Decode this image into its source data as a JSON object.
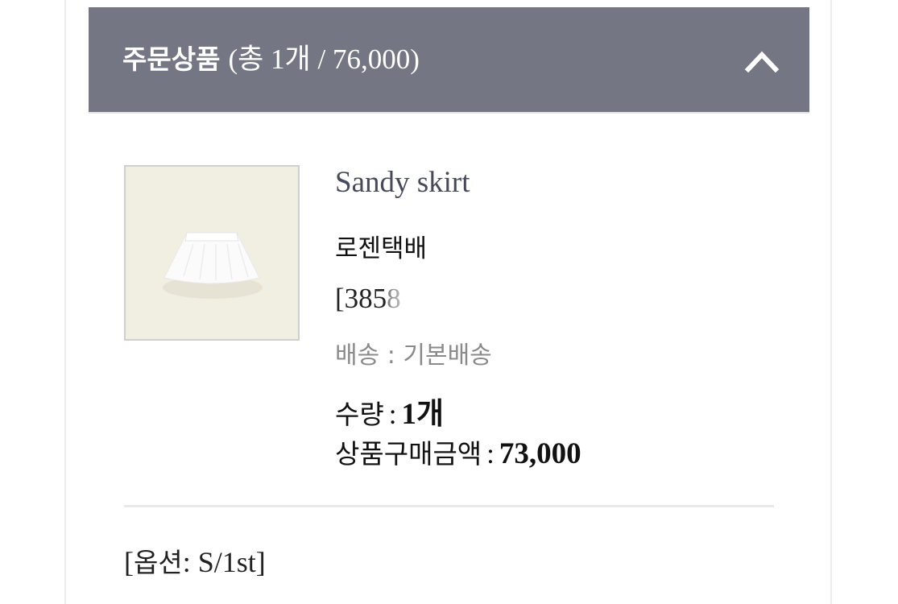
{
  "order_header": {
    "label": "주문상품",
    "summary": "(총 1개 / 76,000)",
    "toggle_icon": "chevron-up-icon",
    "background_color": "#757683"
  },
  "product": {
    "name": "Sandy skirt",
    "carrier": "로젠택배",
    "tracking_code": "[3858",
    "shipping": "배송 : 기본배송",
    "quantity_label": "수량",
    "quantity_value": "1개",
    "price_label": "상품구매금액",
    "price_value": "73,000",
    "separator": ":",
    "thumbnail_icon": "skirt-image"
  },
  "option": {
    "open_bracket": "[",
    "label": "옵션",
    "value": ": S/1st]"
  }
}
